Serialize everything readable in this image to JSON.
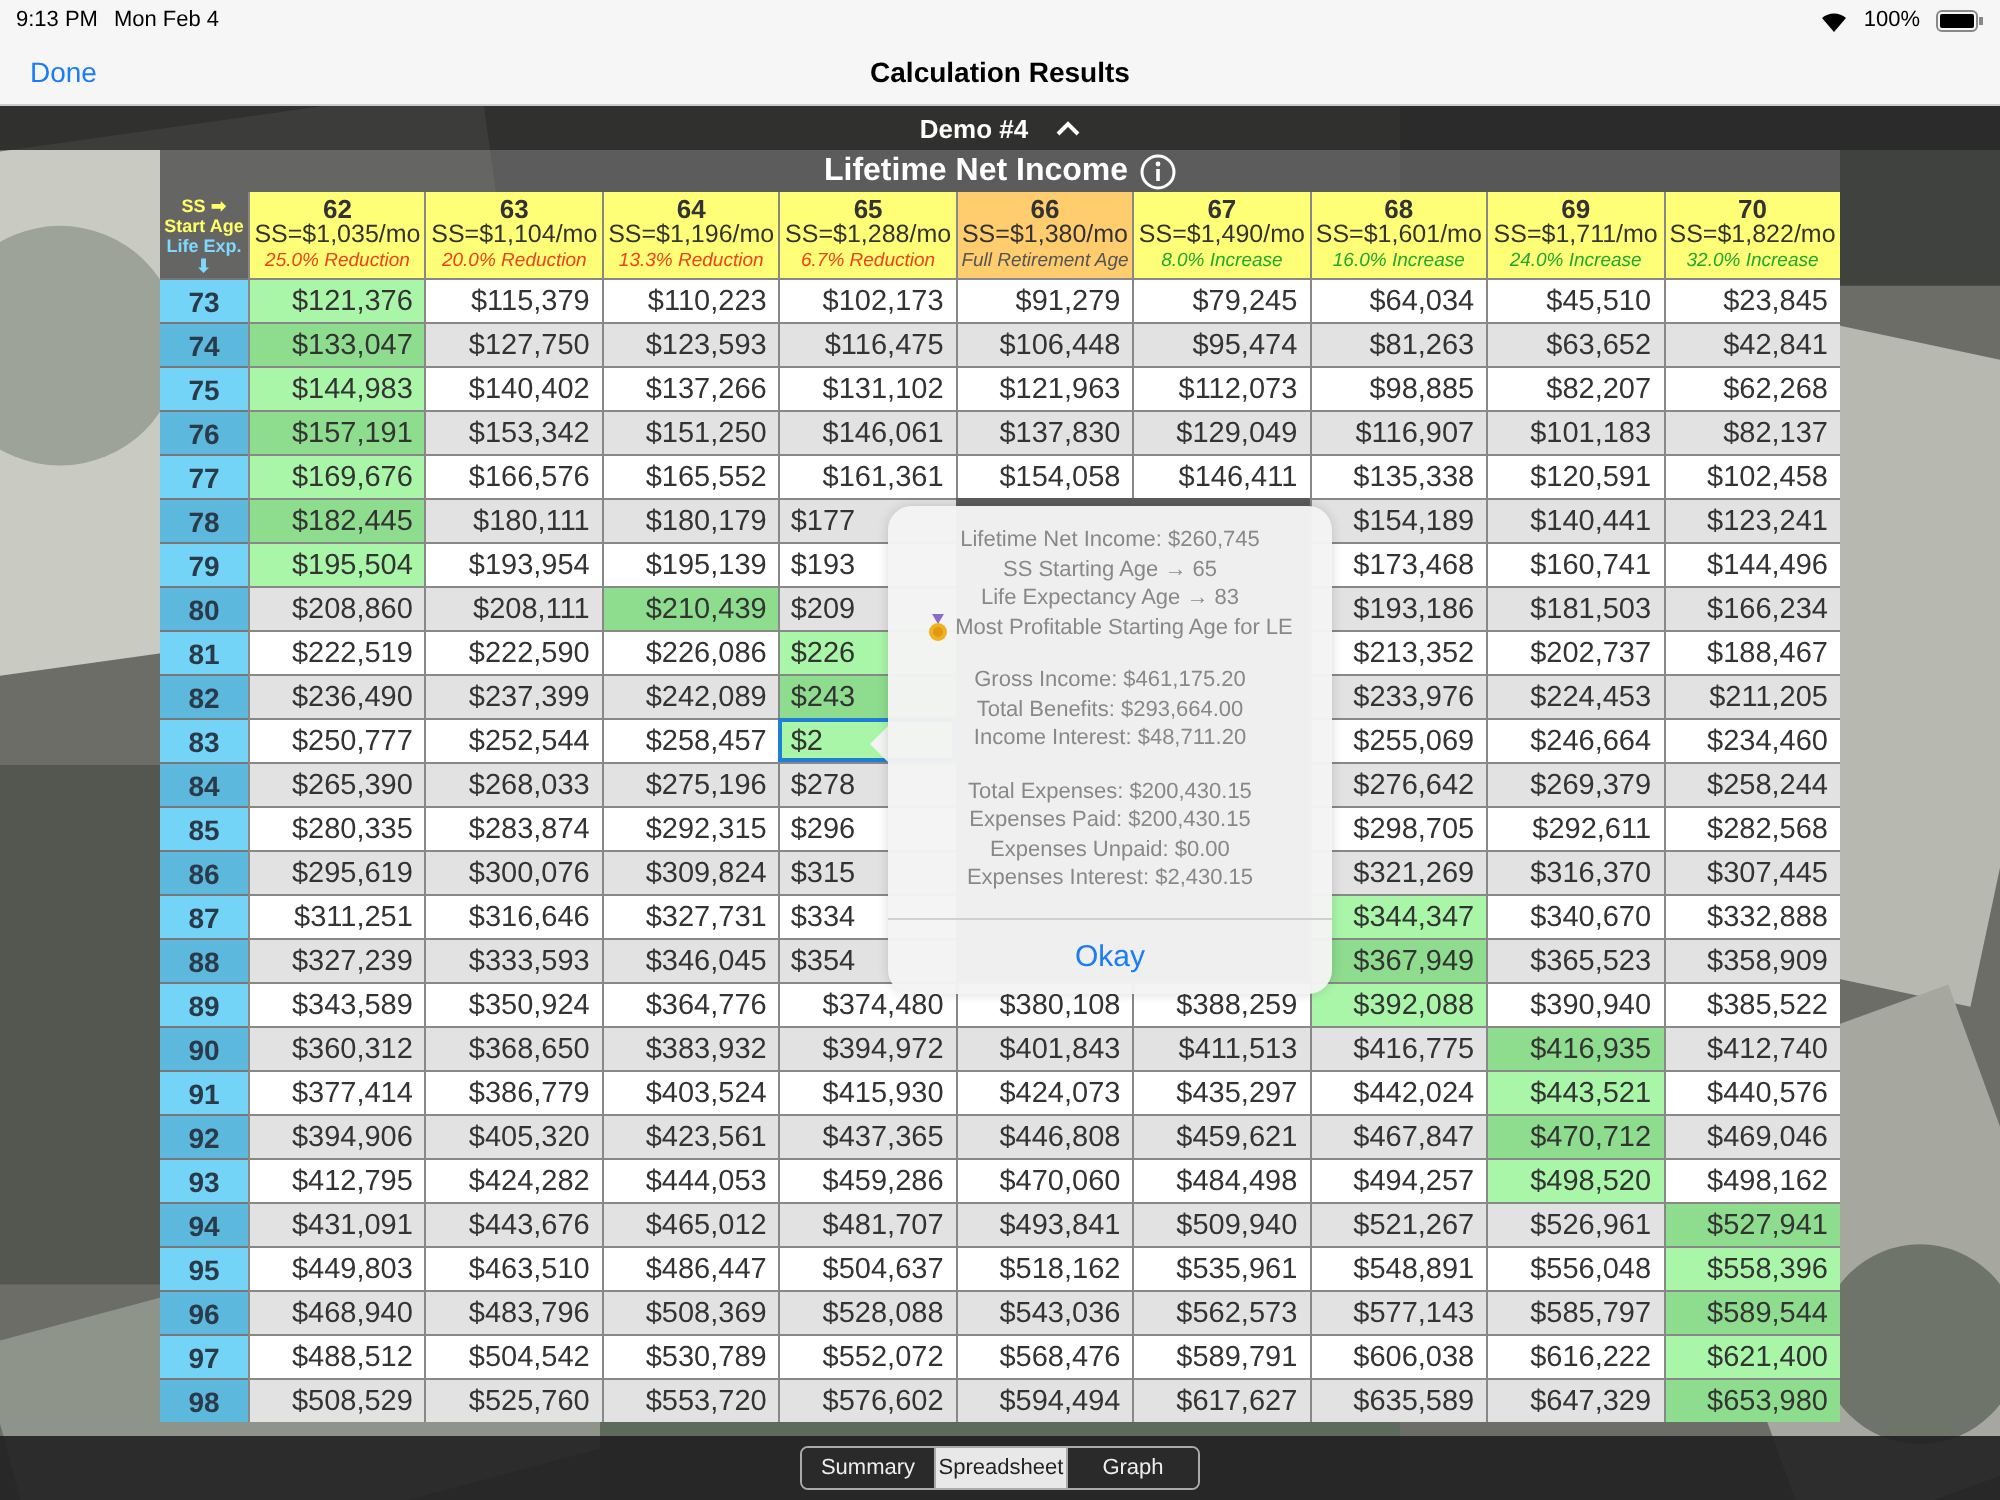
{
  "status_bar": {
    "time": "9:13 PM",
    "date": "Mon Feb 4",
    "battery": "100%"
  },
  "nav": {
    "done": "Done",
    "title": "Calculation Results"
  },
  "demo_bar": {
    "title": "Demo #4"
  },
  "table": {
    "title": "Lifetime Net Income",
    "corner": {
      "ss": "SS",
      "ss_arrow": "➡",
      "start": "Start Age",
      "life": "Life Exp.",
      "life_arrow": "⬇"
    },
    "columns": [
      {
        "age": "62",
        "amount": "SS=$1,035/mo",
        "note": "25.0% Reduction",
        "kind": "reduction"
      },
      {
        "age": "63",
        "amount": "SS=$1,104/mo",
        "note": "20.0% Reduction",
        "kind": "reduction"
      },
      {
        "age": "64",
        "amount": "SS=$1,196/mo",
        "note": "13.3% Reduction",
        "kind": "reduction"
      },
      {
        "age": "65",
        "amount": "SS=$1,288/mo",
        "note": "6.7% Reduction",
        "kind": "reduction"
      },
      {
        "age": "66",
        "amount": "SS=$1,380/mo",
        "note": "Full Retirement Age",
        "kind": "full"
      },
      {
        "age": "67",
        "amount": "SS=$1,490/mo",
        "note": "8.0% Increase",
        "kind": "increase"
      },
      {
        "age": "68",
        "amount": "SS=$1,601/mo",
        "note": "16.0% Increase",
        "kind": "increase"
      },
      {
        "age": "69",
        "amount": "SS=$1,711/mo",
        "note": "24.0% Increase",
        "kind": "increase"
      },
      {
        "age": "70",
        "amount": "SS=$1,822/mo",
        "note": "32.0% Increase",
        "kind": "increase"
      }
    ],
    "rows": [
      {
        "age": "73",
        "selected": false,
        "cells": [
          {
            "v": "$121,376",
            "best": true
          },
          "$115,379",
          "$110,223",
          "$102,173",
          "$91,279",
          "$79,245",
          "$64,034",
          "$45,510",
          "$23,845"
        ]
      },
      {
        "age": "74",
        "selected": false,
        "cells": [
          {
            "v": "$133,047",
            "best": true
          },
          "$127,750",
          "$123,593",
          "$116,475",
          "$106,448",
          "$95,474",
          "$81,263",
          "$63,652",
          "$42,841"
        ]
      },
      {
        "age": "75",
        "selected": false,
        "cells": [
          {
            "v": "$144,983",
            "best": true
          },
          "$140,402",
          "$137,266",
          "$131,102",
          "$121,963",
          "$112,073",
          "$98,885",
          "$82,207",
          "$62,268"
        ]
      },
      {
        "age": "76",
        "selected": false,
        "cells": [
          {
            "v": "$157,191",
            "best": true
          },
          "$153,342",
          "$151,250",
          "$146,061",
          "$137,830",
          "$129,049",
          "$116,907",
          "$101,183",
          "$82,137"
        ]
      },
      {
        "age": "77",
        "selected": false,
        "cells": [
          {
            "v": "$169,676",
            "best": true
          },
          "$166,576",
          "$165,552",
          "$161,361",
          "$154,058",
          "$146,411",
          "$135,338",
          "$120,591",
          "$102,458"
        ]
      },
      {
        "age": "78",
        "selected": false,
        "cells": [
          {
            "v": "$182,445",
            "best": true
          },
          "$180,111",
          "$180,179",
          "$177",
          null,
          null,
          "$154,189",
          "$140,441",
          "$123,241"
        ]
      },
      {
        "age": "79",
        "selected": false,
        "cells": [
          {
            "v": "$195,504",
            "best": true
          },
          "$193,954",
          "$195,139",
          "$193",
          null,
          null,
          "$173,468",
          "$160,741",
          "$144,496"
        ]
      },
      {
        "age": "80",
        "selected": false,
        "cells": [
          "$208,860",
          "$208,111",
          {
            "v": "$210,439",
            "best": true
          },
          "$209",
          null,
          null,
          "$193,186",
          "$181,503",
          "$166,234"
        ]
      },
      {
        "age": "81",
        "selected": false,
        "cells": [
          "$222,519",
          "$222,590",
          "$226,086",
          {
            "v": "$226",
            "best": true
          },
          null,
          null,
          "$213,352",
          "$202,737",
          "$188,467"
        ]
      },
      {
        "age": "82",
        "selected": false,
        "cells": [
          "$236,490",
          "$237,399",
          "$242,089",
          {
            "v": "$243",
            "best": true
          },
          null,
          null,
          "$233,976",
          "$224,453",
          "$211,205"
        ]
      },
      {
        "age": "83",
        "selected": true,
        "cells": [
          "$250,777",
          "$252,544",
          "$258,457",
          {
            "v": "$2",
            "best": true
          },
          null,
          null,
          "$255,069",
          "$246,664",
          "$234,460"
        ]
      },
      {
        "age": "84",
        "selected": false,
        "cells": [
          "$265,390",
          "$268,033",
          "$275,196",
          "$278",
          null,
          null,
          "$276,642",
          "$269,379",
          "$258,244"
        ]
      },
      {
        "age": "85",
        "selected": false,
        "cells": [
          "$280,335",
          "$283,874",
          "$292,315",
          "$296",
          null,
          null,
          "$298,705",
          "$292,611",
          "$282,568"
        ]
      },
      {
        "age": "86",
        "selected": false,
        "cells": [
          "$295,619",
          "$300,076",
          "$309,824",
          "$315",
          null,
          null,
          "$321,269",
          "$316,370",
          "$307,445"
        ]
      },
      {
        "age": "87",
        "selected": false,
        "cells": [
          "$311,251",
          "$316,646",
          "$327,731",
          "$334",
          null,
          null,
          {
            "v": "$344,347",
            "best": true
          },
          "$340,670",
          "$332,888"
        ]
      },
      {
        "age": "88",
        "selected": false,
        "cells": [
          "$327,239",
          "$333,593",
          "$346,045",
          "$354",
          null,
          null,
          {
            "v": "$367,949",
            "best": true
          },
          "$365,523",
          "$358,909"
        ]
      },
      {
        "age": "89",
        "selected": false,
        "cells": [
          "$343,589",
          "$350,924",
          "$364,776",
          "$374,480",
          "$380,108",
          "$388,259",
          {
            "v": "$392,088",
            "best": true
          },
          "$390,940",
          "$385,522"
        ]
      },
      {
        "age": "90",
        "selected": false,
        "cells": [
          "$360,312",
          "$368,650",
          "$383,932",
          "$394,972",
          "$401,843",
          "$411,513",
          "$416,775",
          {
            "v": "$416,935",
            "best": true
          },
          "$412,740"
        ]
      },
      {
        "age": "91",
        "selected": false,
        "cells": [
          "$377,414",
          "$386,779",
          "$403,524",
          "$415,930",
          "$424,073",
          "$435,297",
          "$442,024",
          {
            "v": "$443,521",
            "best": true
          },
          "$440,576"
        ]
      },
      {
        "age": "92",
        "selected": false,
        "cells": [
          "$394,906",
          "$405,320",
          "$423,561",
          "$437,365",
          "$446,808",
          "$459,621",
          "$467,847",
          {
            "v": "$470,712",
            "best": true
          },
          "$469,046"
        ]
      },
      {
        "age": "93",
        "selected": false,
        "cells": [
          "$412,795",
          "$424,282",
          "$444,053",
          "$459,286",
          "$470,060",
          "$484,498",
          "$494,257",
          {
            "v": "$498,520",
            "best": true
          },
          "$498,162"
        ]
      },
      {
        "age": "94",
        "selected": false,
        "cells": [
          "$431,091",
          "$443,676",
          "$465,012",
          "$481,707",
          "$493,841",
          "$509,940",
          "$521,267",
          "$526,961",
          {
            "v": "$527,941",
            "best": true
          }
        ]
      },
      {
        "age": "95",
        "selected": false,
        "cells": [
          "$449,803",
          "$463,510",
          "$486,447",
          "$504,637",
          "$518,162",
          "$535,961",
          "$548,891",
          "$556,048",
          {
            "v": "$558,396",
            "best": true
          }
        ]
      },
      {
        "age": "96",
        "selected": false,
        "cells": [
          "$468,940",
          "$483,796",
          "$508,369",
          "$528,088",
          "$543,036",
          "$562,573",
          "$577,143",
          "$585,797",
          {
            "v": "$589,544",
            "best": true
          }
        ]
      },
      {
        "age": "97",
        "selected": false,
        "cells": [
          "$488,512",
          "$504,542",
          "$530,789",
          "$552,072",
          "$568,476",
          "$589,791",
          "$606,038",
          "$616,222",
          {
            "v": "$621,400",
            "best": true
          }
        ]
      },
      {
        "age": "98",
        "selected": false,
        "cells": [
          "$508,529",
          "$525,760",
          "$553,720",
          "$576,602",
          "$594,494",
          "$617,627",
          "$635,589",
          "$647,329",
          {
            "v": "$653,980",
            "best": true
          }
        ]
      }
    ]
  },
  "popup": {
    "groups": [
      [
        {
          "text": "Lifetime Net Income: $260,745",
          "kind": "text"
        },
        {
          "text": "SS Starting Age → 65",
          "kind": "text"
        },
        {
          "text": "Life Expectancy Age → 83",
          "kind": "text"
        },
        {
          "text": "Most Profitable Starting Age for LE",
          "kind": "award"
        }
      ],
      [
        {
          "text": "Gross Income: $461,175.20",
          "kind": "text"
        },
        {
          "text": "Total Benefits: $293,664.00",
          "kind": "text"
        },
        {
          "text": "Income Interest: $48,711.20",
          "kind": "text"
        }
      ],
      [
        {
          "text": "Total Expenses: $200,430.15",
          "kind": "text"
        },
        {
          "text": "Expenses Paid: $200,430.15",
          "kind": "text"
        },
        {
          "text": "Expenses Unpaid: $0.00",
          "kind": "text"
        },
        {
          "text": "Expenses Interest: $2,430.15",
          "kind": "text"
        }
      ]
    ],
    "button": "Okay"
  },
  "tabs": [
    {
      "label": "Summary",
      "selected": false
    },
    {
      "label": "Spreadsheet",
      "selected": true
    },
    {
      "label": "Graph",
      "selected": false
    }
  ]
}
